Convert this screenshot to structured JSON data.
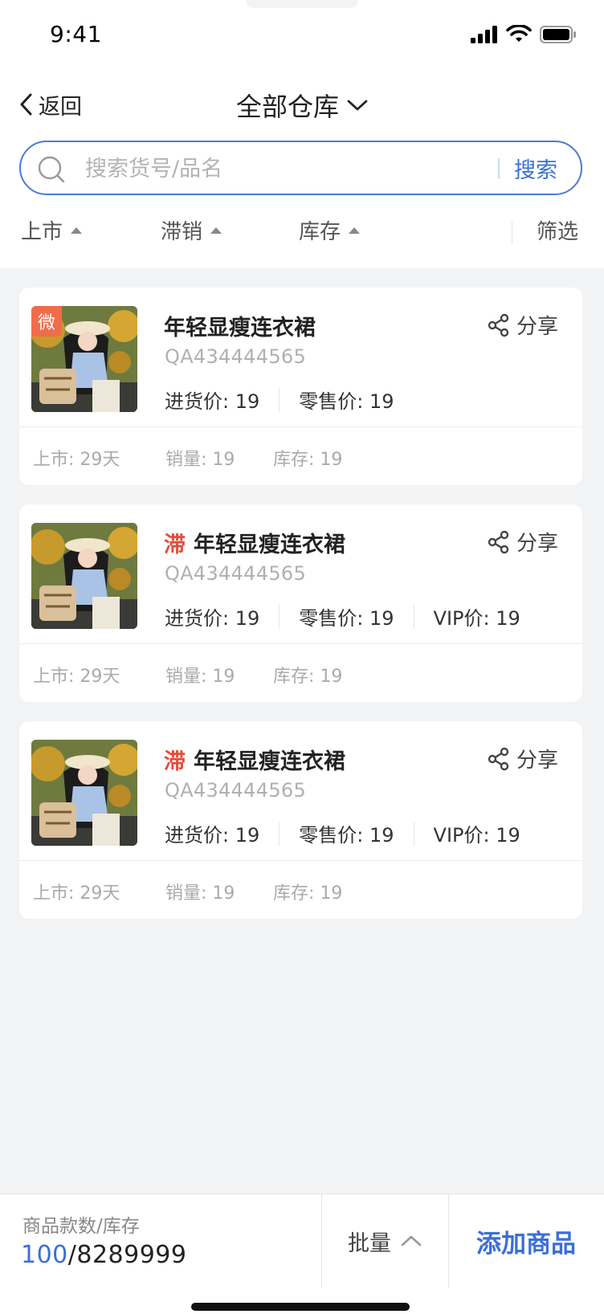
{
  "status_bar": {
    "time": "9:41"
  },
  "nav": {
    "back_label": "返回",
    "title": "全部仓库"
  },
  "search": {
    "placeholder": "搜索货号/品名",
    "value": "",
    "button_label": "搜索"
  },
  "sort": {
    "items": [
      {
        "label": "上市",
        "icon": "sort-up-triangle"
      },
      {
        "label": "滞销",
        "icon": "sort-up-triangle"
      },
      {
        "label": "库存",
        "icon": "sort-up-triangle"
      }
    ],
    "filter_label": "筛选"
  },
  "products": [
    {
      "badge": "微",
      "slow_tag": "",
      "name": "年轻显瘦连衣裙",
      "sku": "QA434444565",
      "share_label": "分享",
      "prices": [
        "进货价: 19",
        "零售价: 19"
      ],
      "stats": [
        "上市: 29天",
        "销量: 19",
        "库存: 19"
      ]
    },
    {
      "badge": "",
      "slow_tag": "滞",
      "name": "年轻显瘦连衣裙",
      "sku": "QA434444565",
      "share_label": "分享",
      "prices": [
        "进货价: 19",
        "零售价: 19",
        "VIP价: 19"
      ],
      "stats": [
        "上市: 29天",
        "销量: 19",
        "库存: 19"
      ]
    },
    {
      "badge": "",
      "slow_tag": "滞",
      "name": "年轻显瘦连衣裙",
      "sku": "QA434444565",
      "share_label": "分享",
      "prices": [
        "进货价: 19",
        "零售价: 19",
        "VIP价: 19"
      ],
      "stats": [
        "上市: 29天",
        "销量: 19",
        "库存: 19"
      ]
    }
  ],
  "bottom": {
    "summary_label": "商品款数/库存",
    "product_count": "100",
    "stock_total": "/8289999",
    "batch_label": "批量",
    "add_label": "添加商品"
  },
  "colors": {
    "accent": "#3a6fd8",
    "slow_tag": "#e34c3b",
    "wei_badge": "#f26b4a",
    "background": "#f2f3f5"
  }
}
